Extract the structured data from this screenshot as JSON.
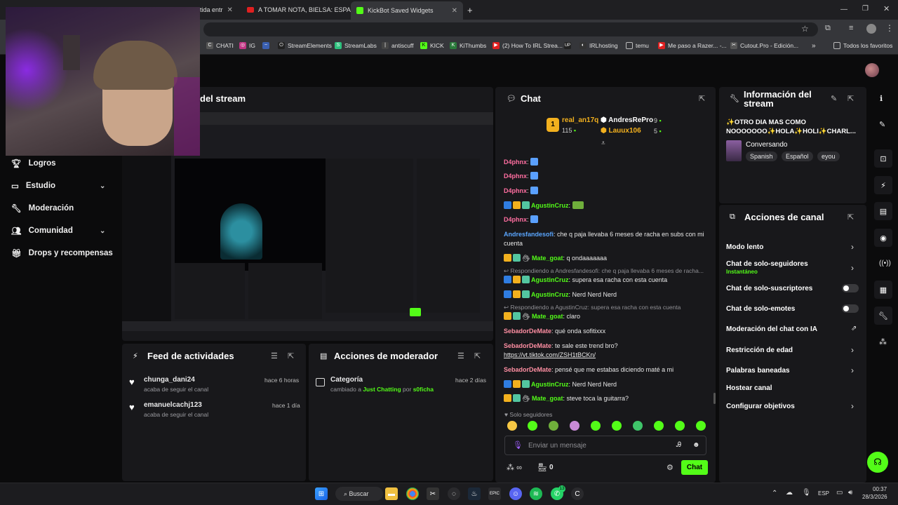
{
  "browser": {
    "tabs": [
      {
        "label": "rtida entr",
        "close": "✕"
      },
      {
        "label": "A TOMAR NOTA, BIELSA: ESPAÑ",
        "close": "✕"
      },
      {
        "label": "KickBot Saved Widgets",
        "close": "✕"
      }
    ],
    "new_tab": "+",
    "bookmarks": [
      "CHATI",
      "IG",
      "StreamElements",
      "StreamLabs",
      "antiscuff",
      "KICK",
      "KiThumbs",
      "(2) How To IRL Strea...",
      "IRLhosting",
      "temu",
      "Me paso a Razer... -...",
      "Cutout.Pro - Edición...",
      "Todos los favoritos"
    ]
  },
  "sidebar": {
    "items": [
      {
        "label": "Logros",
        "icon": "trophy-icon",
        "chevron": false
      },
      {
        "label": "Estudio",
        "icon": "studio-icon",
        "chevron": true
      },
      {
        "label": "Moderación",
        "icon": "wrench-icon",
        "chevron": false
      },
      {
        "label": "Comunidad",
        "icon": "community-icon",
        "chevron": true
      },
      {
        "label": "Drops y recompensas",
        "icon": "drops-icon",
        "chevron": false
      }
    ]
  },
  "preview": {
    "title": "del stream"
  },
  "feed": {
    "title": "Feed de actividades",
    "items": [
      {
        "user": "chunga_dani24",
        "action": "acaba de seguir el canal",
        "time": "hace 6 horas"
      },
      {
        "user": "emanuelcachj123",
        "action": "acaba de seguir el canal",
        "time": "hace 1 día"
      }
    ]
  },
  "modact": {
    "title": "Acciones de moderador",
    "item": {
      "title": "Categoría",
      "prefix": "cambiado a",
      "category": "Just Chatting",
      "by": "por",
      "user": "s0ficha",
      "time": "hace 2 días"
    }
  },
  "chat": {
    "title": "Chat",
    "leaders": [
      {
        "name": "real_an17q",
        "count": "115"
      },
      {
        "name": "AndresRePro",
        "count": "9"
      },
      {
        "name": "Lauux106",
        "count": "5"
      }
    ],
    "leader_rank": "1",
    "messages": [
      {
        "user": "D4phnx",
        "text": ":",
        "color": "#ff6ea0"
      },
      {
        "user": "D4phnx",
        "text": ":",
        "color": "#ff6ea0"
      },
      {
        "user": "D4phnx",
        "text": ":",
        "color": "#ff6ea0"
      },
      {
        "user": "AgustinCruz",
        "text": ":",
        "color": "#53fc18"
      },
      {
        "user": "D4phnx",
        "text": ":",
        "color": "#ff6ea0"
      },
      {
        "user": "Andresfandesofi",
        "text": ": che q paja llevaba 6 meses de racha en subs con mi cuenta",
        "color": "#5aa6ff"
      },
      {
        "user": "Mate_goat",
        "text": ": q ondaaaaaaa",
        "color": "#53fc18"
      },
      {
        "user": "AgustinCruz",
        "text": ": supera esa racha con esta cuenta",
        "color": "#53fc18",
        "reply": "Respondiendo a Andresfandesofi: che q paja llevaba 6 meses de racha..."
      },
      {
        "user": "AgustinCruz",
        "text": ": Nerd Nerd Nerd",
        "color": "#53fc18"
      },
      {
        "user": "Mate_goat",
        "text": ": claro",
        "color": "#53fc18",
        "reply": "Respondiendo a AgustinCruz: supera esa racha con esta cuenta"
      },
      {
        "user": "SebadorDeMate",
        "text": ": qué onda sofitixxx",
        "color": "#ff8fa3"
      },
      {
        "user": "SebadorDeMate",
        "text": ": te sale este trend bro?",
        "color": "#ff8fa3",
        "link": "https://vt.tiktok.com/ZSH1tBCKn/"
      },
      {
        "user": "SebadorDeMate",
        "text": ": pensé que me estabas diciendo maté a mi",
        "color": "#ff8fa3"
      },
      {
        "user": "AgustinCruz",
        "text": ": Nerd Nerd Nerd",
        "color": "#53fc18"
      },
      {
        "user": "Mate_goat",
        "text": ": steve toca la guitarra?",
        "color": "#53fc18"
      }
    ],
    "followers_only": "Solo seguidores",
    "input_placeholder": "Enviar un mensaje",
    "infinity": "∞",
    "points": "0",
    "send_label": "Chat"
  },
  "info": {
    "title": "Información del stream",
    "stream_title": "✨OTRO DIA MAS COMO NOOOOOOO✨HOLA✨HOLI✨CHARL...",
    "category": "Conversando",
    "tags": [
      "Spanish",
      "Español",
      "eyou"
    ]
  },
  "chanact": {
    "title": "Acciones de canal",
    "items": [
      {
        "label": "Modo lento",
        "sub": "",
        "control": "chevron"
      },
      {
        "label": "Chat de solo-seguidores",
        "sub": "Instantáneo",
        "control": "chevron"
      },
      {
        "label": "Chat de solo-suscriptores",
        "sub": "",
        "control": "toggle"
      },
      {
        "label": "Chat de solo-emotes",
        "sub": "",
        "control": "toggle"
      },
      {
        "label": "Moderación del chat con IA",
        "sub": "",
        "control": "external"
      },
      {
        "label": "Restricción de edad",
        "sub": "",
        "control": "chevron"
      },
      {
        "label": "Palabras baneadas",
        "sub": "",
        "control": "chevron"
      },
      {
        "label": "Hostear canal",
        "sub": "",
        "control": "none"
      },
      {
        "label": "Configurar objetivos",
        "sub": "",
        "control": "chevron"
      }
    ]
  },
  "taskbar": {
    "search": "Buscar",
    "lang": "ESP",
    "time": "00:37",
    "date": "28/3/2026",
    "whatsapp_badge": "13"
  },
  "colors": {
    "accent": "#53fc18",
    "panel": "#18181b",
    "bg": "#0b0b0c"
  }
}
